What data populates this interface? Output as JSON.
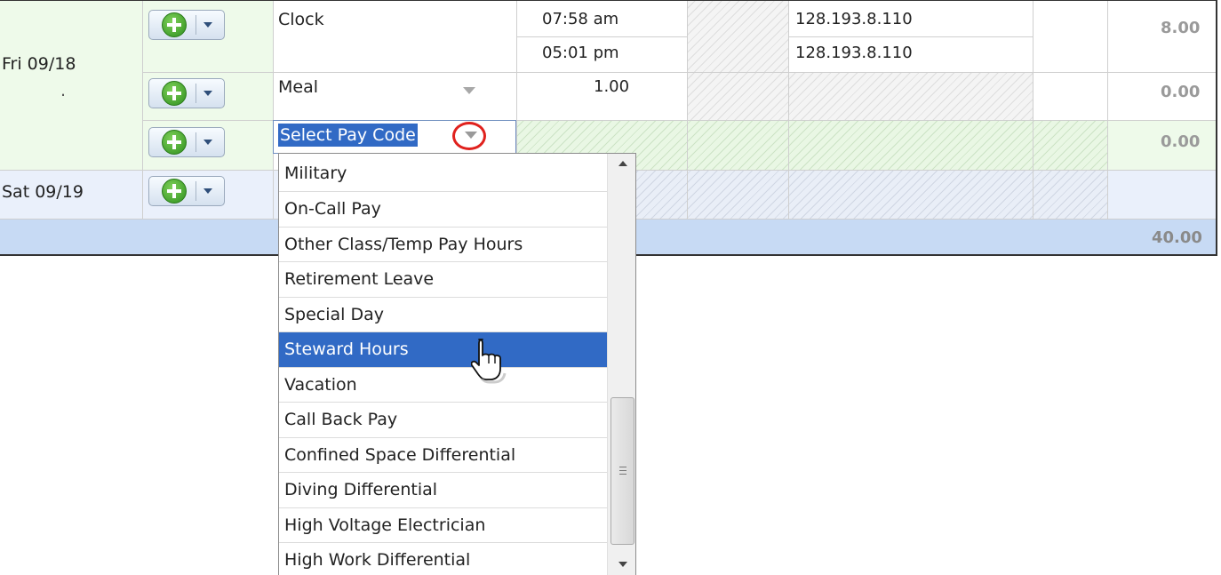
{
  "timesheet": {
    "fri": {
      "day": "Fri 09/18",
      "dot": ".",
      "clock_row": {
        "type": "Clock",
        "in_time": "07:58 am",
        "out_time": "05:01 pm",
        "in_ip": "128.193.8.110",
        "out_ip": "128.193.8.110",
        "hours": "8.00"
      },
      "meal_row": {
        "type": "Meal",
        "value": "1.00",
        "hours": "0.00"
      },
      "new_row": {
        "select_text": "Select Pay Code",
        "hours": "0.00"
      }
    },
    "sat": {
      "day": "Sat 09/19"
    },
    "total": "40.00"
  },
  "dropdown": {
    "options": [
      "Military",
      "On-Call Pay",
      "Other Class/Temp Pay Hours",
      "Retirement Leave",
      "Special Day",
      "Steward Hours",
      "Vacation",
      "Call Back Pay",
      "Confined Space Differential",
      "Diving Differential",
      "High Voltage Electrician",
      "High Work Differential"
    ],
    "selected": "Steward Hours"
  },
  "colors": {
    "fri_bg": "#eefaea",
    "sat_bg": "#eaf0fb",
    "total_bar": "#c7daf4",
    "selection": "#316ac5",
    "highlight_circle": "#e0211d"
  },
  "icons": {
    "add_button": "plus-circle-icon",
    "add_menu": "chevron-down-icon",
    "cursor": "hand-pointer-icon"
  }
}
